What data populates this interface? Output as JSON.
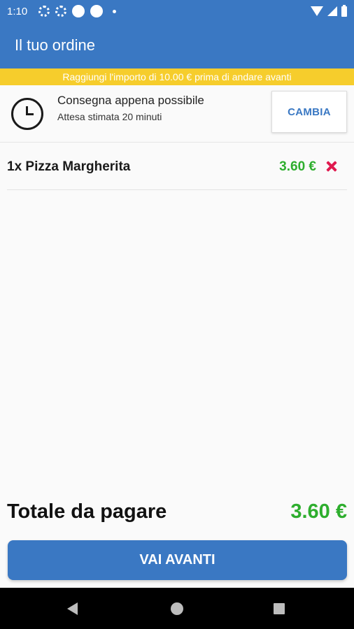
{
  "status_bar": {
    "time": "1:10"
  },
  "app_bar": {
    "title": "Il tuo ordine"
  },
  "notice": {
    "text": "Raggiungi l'importo di 10.00 € prima di andare avanti"
  },
  "delivery": {
    "title": "Consegna appena possibile",
    "subtitle": "Attesa stimata 20 minuti",
    "change_label": "CAMBIA"
  },
  "items": [
    {
      "name": "1x Pizza Margherita",
      "price": "3.60 €"
    }
  ],
  "total": {
    "label": "Totale da pagare",
    "value": "3.60 €"
  },
  "proceed_button": {
    "label": "VAI AVANTI"
  },
  "colors": {
    "primary": "#3a78c3",
    "notice": "#f6cd2c",
    "price": "#2eae2e",
    "remove": "#e01a4f"
  },
  "icons": [
    "settings-icon",
    "clock-icon",
    "remove-icon",
    "wifi-icon",
    "signal-icon",
    "battery-icon",
    "nav-back-icon",
    "nav-home-icon",
    "nav-recents-icon"
  ]
}
